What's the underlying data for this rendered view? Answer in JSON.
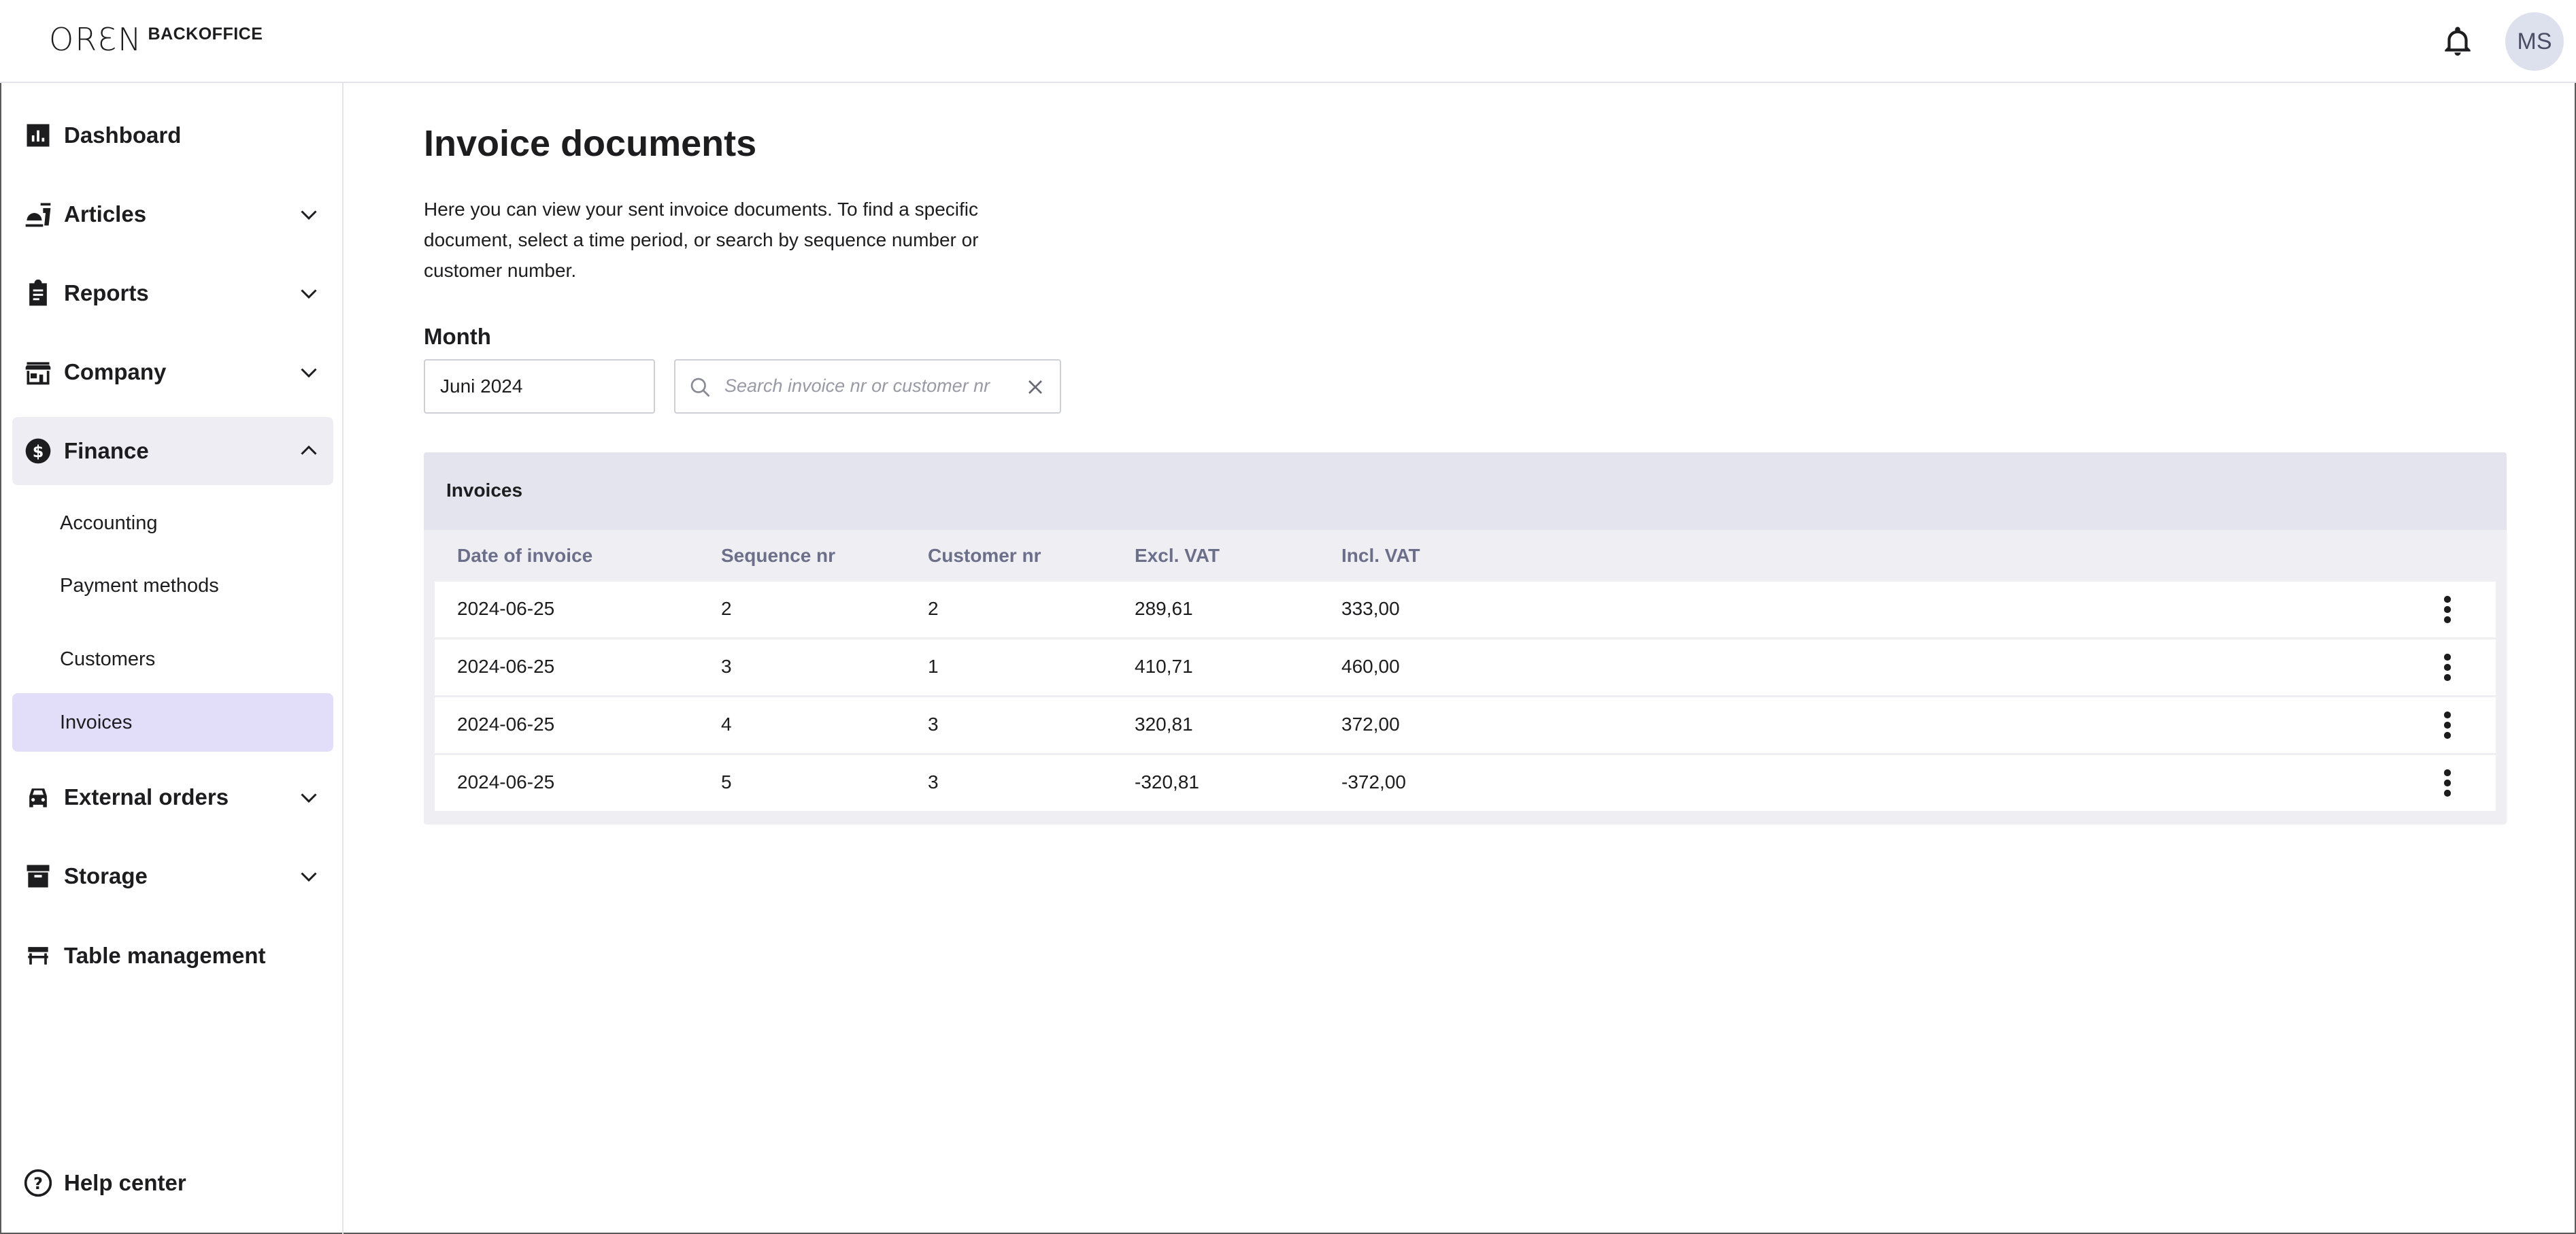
{
  "header": {
    "logo_mark": "ORƐN",
    "logo_text": "BACKOFFICE",
    "avatar_initials": "MS"
  },
  "sidebar": {
    "items": [
      {
        "label": "Dashboard",
        "icon": "bar-chart-icon"
      },
      {
        "label": "Articles",
        "icon": "food-icon"
      },
      {
        "label": "Reports",
        "icon": "clipboard-icon"
      },
      {
        "label": "Company",
        "icon": "store-icon"
      },
      {
        "label": "Finance",
        "icon": "dollar-circle-icon"
      },
      {
        "label": "External orders",
        "icon": "car-icon"
      },
      {
        "label": "Storage",
        "icon": "archive-icon"
      },
      {
        "label": "Table management",
        "icon": "table-icon"
      }
    ],
    "finance_sub": [
      "Accounting",
      "Payment methods",
      "Customers",
      "Invoices"
    ],
    "help": "Help center"
  },
  "main": {
    "title": "Invoice documents",
    "description": "Here you can view your sent invoice documents. To find a specific document, select a time period, or search by sequence number or customer number.",
    "month_label": "Month",
    "month_value": "Juni 2024",
    "search_placeholder": "Search invoice nr or customer nr"
  },
  "table": {
    "title": "Invoices",
    "columns": [
      "Date of invoice",
      "Sequence nr",
      "Customer nr",
      "Excl. VAT",
      "Incl. VAT"
    ],
    "rows": [
      [
        "2024-06-25",
        "2",
        "2",
        "289,61",
        "333,00"
      ],
      [
        "2024-06-25",
        "3",
        "1",
        "410,71",
        "460,00"
      ],
      [
        "2024-06-25",
        "4",
        "3",
        "320,81",
        "372,00"
      ],
      [
        "2024-06-25",
        "5",
        "3",
        "-320,81",
        "-372,00"
      ]
    ]
  },
  "colors": {
    "active_sub_bg": "#e2defa",
    "open_item_bg": "#ededf3",
    "table_header_bg": "#e3e4ee",
    "column_header_text": "#6b6f8a"
  }
}
